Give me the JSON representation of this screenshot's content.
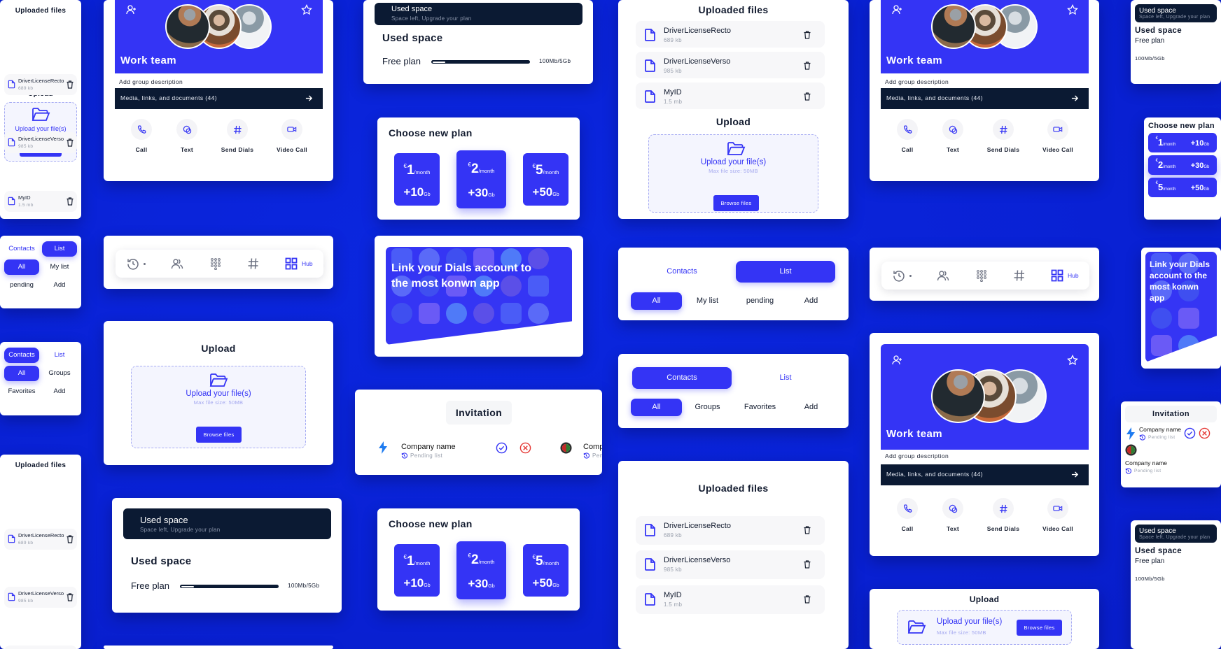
{
  "colors": {
    "background": "#0a23d8",
    "accent": "#3434f5",
    "dark": "#0b1a33",
    "danger": "#e53935"
  },
  "cards": {
    "a1_files": {
      "title": "Uploaded files",
      "files": [
        {
          "name": "DriverLicenseRecto",
          "size": "689 kb"
        },
        {
          "name": "DriverLicenseVerso",
          "size": "985 kb"
        },
        {
          "name": "MyID",
          "size": "1.5 mb"
        }
      ],
      "upload_title": "Upload",
      "upload": {
        "text": "Upload your file(s)",
        "max": "Max file size: 50MB",
        "button": "Browse files"
      }
    },
    "a2_tabs": {
      "tabs": [
        "Contacts",
        "List"
      ],
      "active_tab": 1,
      "pills": [
        "All",
        "My list",
        "pending",
        "Add"
      ],
      "active_pill": 0
    },
    "a3_tabs": {
      "tabs": [
        "Contacts",
        "List"
      ],
      "active_tab": 0,
      "pills": [
        "All",
        "Groups",
        "Favorites",
        "Add"
      ],
      "active_pill": 0
    },
    "a4_files": {
      "title": "Uploaded files",
      "files": [
        {
          "name": "DriverLicenseRecto",
          "size": "689 kb"
        },
        {
          "name": "DriverLicenseVerso",
          "size": "985 kb"
        },
        {
          "name": "MyID",
          "size": "1.5 mb"
        }
      ]
    },
    "b1_group": {
      "title": "Work team",
      "description": "Add group description",
      "media_label": "Media, links, and documents (44)",
      "actions": [
        "Call",
        "Text",
        "Send Dials",
        "Video Call"
      ]
    },
    "b2_nav": {
      "items": [
        {
          "icon": "history-icon"
        },
        {
          "icon": "users-icon"
        },
        {
          "icon": "dialpad-icon"
        },
        {
          "icon": "hash-icon"
        },
        {
          "icon": "grid-icon",
          "label": "Hub",
          "active": true
        }
      ]
    },
    "b3_upload": {
      "title": "Upload",
      "upload": {
        "text": "Upload your file(s)",
        "max": "Max file size: 50MB",
        "button": "Browse files"
      }
    },
    "b4_used": {
      "banner_title": "Used space",
      "banner_subtitle": "Space left, Upgrade your plan",
      "heading": "Used space",
      "plan": "Free plan",
      "usage": "100Mb/5Gb",
      "usage_fraction": 0.02
    },
    "c1_used": {
      "banner_title": "Used space",
      "banner_subtitle": "Space left, Upgrade your plan",
      "heading": "Used space",
      "plan": "Free plan",
      "usage": "100Mb/5Gb",
      "usage_fraction": 0.02
    },
    "c2_plans": {
      "title": "Choose new plan",
      "plans": [
        {
          "currency": "€",
          "price": "1",
          "period": "/month",
          "storage": "+10",
          "unit": "Gb"
        },
        {
          "currency": "€",
          "price": "2",
          "period": "/month",
          "storage": "+30",
          "unit": "Gb"
        },
        {
          "currency": "€",
          "price": "5",
          "period": "/month",
          "storage": "+50",
          "unit": "Gb"
        }
      ]
    },
    "c3_link": {
      "text": "Link your Dials account to the most konwn app"
    },
    "c4_invite": {
      "title": "Invitation",
      "rows": [
        {
          "name": "Company name",
          "status": "Pending list"
        },
        {
          "name": "Company name",
          "status": "Pending list"
        }
      ]
    },
    "c5_plans": {
      "title": "Choose new plan",
      "plans": [
        {
          "currency": "€",
          "price": "1",
          "period": "/month",
          "storage": "+10",
          "unit": "Gb"
        },
        {
          "currency": "€",
          "price": "2",
          "period": "/month",
          "storage": "+30",
          "unit": "Gb"
        },
        {
          "currency": "€",
          "price": "5",
          "period": "/month",
          "storage": "+50",
          "unit": "Gb"
        }
      ]
    },
    "d1_files": {
      "title": "Uploaded files",
      "files": [
        {
          "name": "DriverLicenseRecto",
          "size": "689 kb"
        },
        {
          "name": "DriverLicenseVerso",
          "size": "985 kb"
        },
        {
          "name": "MyID",
          "size": "1.5 mb"
        }
      ],
      "upload_title": "Upload",
      "upload": {
        "text": "Upload your file(s)",
        "max": "Max file size: 50MB",
        "button": "Browse files"
      }
    },
    "d2_tabs": {
      "tabs": [
        "Contacts",
        "List"
      ],
      "active_tab": 1,
      "pills": [
        "All",
        "My list",
        "pending",
        "Add"
      ],
      "active_pill": 0
    },
    "d3_tabs": {
      "tabs": [
        "Contacts",
        "List"
      ],
      "active_tab": 0,
      "pills": [
        "All",
        "Groups",
        "Favorites",
        "Add"
      ],
      "active_pill": 0
    },
    "d4_files": {
      "title": "Uploaded files",
      "files": [
        {
          "name": "DriverLicenseRecto",
          "size": "689 kb"
        },
        {
          "name": "DriverLicenseVerso",
          "size": "985 kb"
        },
        {
          "name": "MyID",
          "size": "1.5 mb"
        }
      ]
    },
    "e1_group": {
      "title": "Work team",
      "description": "Add group description",
      "media_label": "Media, links, and documents (44)",
      "actions": [
        "Call",
        "Text",
        "Send Dials",
        "Video Call"
      ]
    },
    "e2_nav": {
      "items": [
        {
          "icon": "history-icon"
        },
        {
          "icon": "users-icon"
        },
        {
          "icon": "dialpad-icon"
        },
        {
          "icon": "hash-icon"
        },
        {
          "icon": "grid-icon",
          "label": "Hub",
          "active": true
        }
      ]
    },
    "e3_group": {
      "title": "Work team",
      "description": "Add group description",
      "media_label": "Media, links, and documents (44)",
      "actions": [
        "Call",
        "Text",
        "Send Dials",
        "Video Call"
      ]
    },
    "e4_upload": {
      "title": "Upload",
      "upload": {
        "text": "Upload your file(s)",
        "max": "Max file size: 50MB",
        "button": "Browse files"
      }
    },
    "f1_used": {
      "banner_title": "Used space",
      "banner_subtitle": "Space left, Upgrade your plan",
      "heading": "Used space",
      "plan": "Free plan",
      "usage": "100Mb/5Gb",
      "usage_fraction": 0.02
    },
    "f2_plans": {
      "title": "Choose new plan",
      "plans": [
        {
          "currency": "€",
          "price": "1",
          "period": "/month",
          "storage": "+10",
          "unit": "Gb"
        },
        {
          "currency": "€",
          "price": "2",
          "period": "/month",
          "storage": "+30",
          "unit": "Gb"
        },
        {
          "currency": "€",
          "price": "5",
          "period": "/month",
          "storage": "+50",
          "unit": "Gb"
        }
      ]
    },
    "f3_link": {
      "text": "Link your Dials account to the most konwn app"
    },
    "f4_invite": {
      "title": "Invitation",
      "rows": [
        {
          "name": "Company name",
          "status": "Pending list"
        },
        {
          "name": "Company name",
          "status": "Pending list"
        }
      ]
    },
    "f5_used": {
      "banner_title": "Used space",
      "banner_subtitle": "Space left, Upgrade your plan",
      "heading": "Used space",
      "plan": "Free plan",
      "usage": "100Mb/5Gb",
      "usage_fraction": 0.02
    }
  }
}
